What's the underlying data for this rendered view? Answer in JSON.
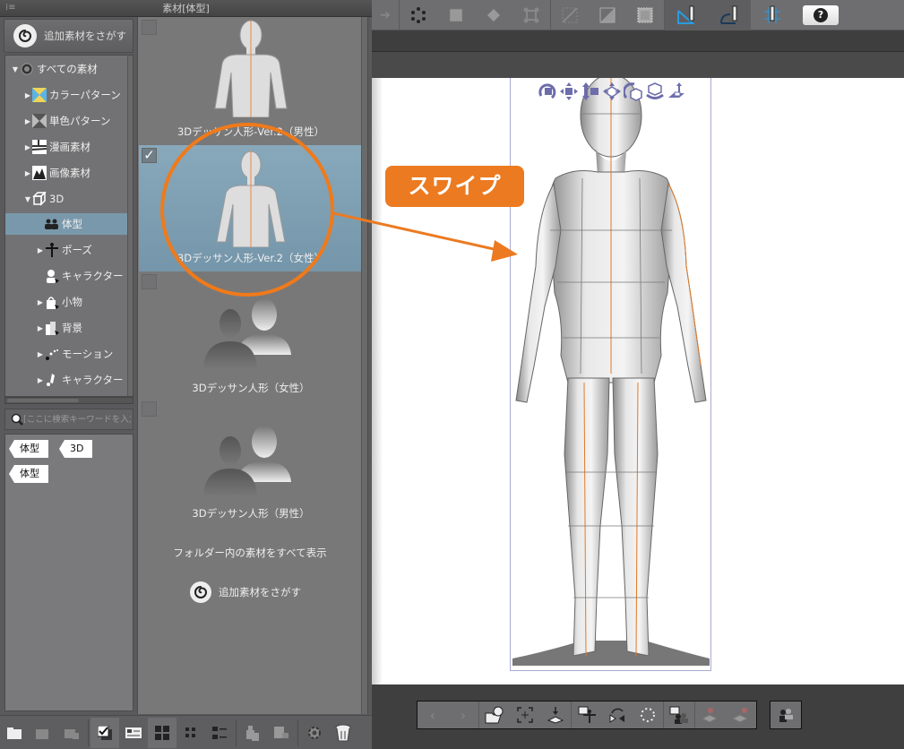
{
  "panel": {
    "title": "素材[体型]",
    "find_more": "追加素材をさがす",
    "tree": [
      {
        "label": "すべての素材",
        "icon": "all-materials-icon",
        "expanded": true,
        "level": 0
      },
      {
        "label": "カラーパターン",
        "icon": "color-pattern-icon",
        "expanded": false,
        "level": 1
      },
      {
        "label": "単色パターン",
        "icon": "mono-pattern-icon",
        "expanded": false,
        "level": 1
      },
      {
        "label": "漫画素材",
        "icon": "manga-material-icon",
        "expanded": false,
        "level": 1
      },
      {
        "label": "画像素材",
        "icon": "image-material-icon",
        "expanded": false,
        "level": 1
      },
      {
        "label": "3D",
        "icon": "3d-cube-icon",
        "expanded": true,
        "level": 1
      },
      {
        "label": "体型",
        "icon": "body-type-icon",
        "selected": true,
        "level": 2
      },
      {
        "label": "ポーズ",
        "icon": "pose-icon",
        "expanded": false,
        "level": 2
      },
      {
        "label": "キャラクター",
        "icon": "character-icon",
        "level": 2
      },
      {
        "label": "小物",
        "icon": "small-object-icon",
        "expanded": false,
        "level": 2
      },
      {
        "label": "背景",
        "icon": "background-icon",
        "expanded": false,
        "level": 2
      },
      {
        "label": "モーション",
        "icon": "motion-icon",
        "expanded": false,
        "level": 2
      },
      {
        "label": "キャラクター",
        "icon": "character-motion-icon",
        "expanded": false,
        "level": 2
      }
    ],
    "search_placeholder": "[ここに検索キーワードを入力]",
    "tags": [
      "体型",
      "3D",
      "体型"
    ],
    "items": [
      {
        "label": "3Dデッサン人形-Ver.2（男性）",
        "checked": false,
        "selected": false,
        "thumb": "figure"
      },
      {
        "label": "3Dデッサン人形-Ver.2（女性）",
        "checked": true,
        "selected": true,
        "thumb": "figure"
      },
      {
        "label": "3Dデッサン人形（女性）",
        "checked": false,
        "selected": false,
        "thumb": "silhouette"
      },
      {
        "label": "3Dデッサン人形（男性）",
        "checked": false,
        "selected": false,
        "thumb": "silhouette"
      }
    ],
    "show_all_link": "フォルダー内の素材をすべて表示",
    "find_more_bottom": "追加素材をさがす",
    "bottom_buttons": [
      "new-folder-icon",
      "add-material-icon",
      "delete-folder-icon",
      "checkbox-toggle-icon",
      "detail-view-icon",
      "large-thumb-icon",
      "small-thumb-icon",
      "list-view-icon",
      "paste-to-canvas-icon",
      "replace-icon",
      "settings-icon",
      "trash-icon"
    ]
  },
  "toolbar": {
    "buttons": [
      "forward-icon",
      "lasso-points-icon",
      "expand-selection-icon",
      "fill-icon",
      "transform-icon",
      "snap-line-icon",
      "snap-fill-icon",
      "snap-grid-icon",
      "snap-ruler-icon",
      "snap-special-ruler-icon",
      "snap-grid-pen-icon"
    ],
    "help_label": "?"
  },
  "annotation": {
    "label": "スワイプ",
    "color": "#ec7a20"
  },
  "model_tools": [
    "camera-rotate-icon",
    "camera-pan-icon",
    "camera-dolly-icon",
    "move-object-icon",
    "rotate-object-icon",
    "rotate-object-2-icon",
    "move-on-plane-icon"
  ],
  "object_launcher": {
    "groups": [
      [
        "prev-icon",
        "next-icon"
      ],
      [
        "open-body-shape-icon",
        "fit-to-view-icon",
        "place-on-ground-icon"
      ],
      [
        "save-pose-icon",
        "flip-pose-icon",
        "reset-pose-icon"
      ],
      [
        "register-body-icon"
      ],
      [
        "lock-joints-icon",
        "unlock-joints-icon"
      ]
    ],
    "extra": "body-shape-settings-icon"
  }
}
